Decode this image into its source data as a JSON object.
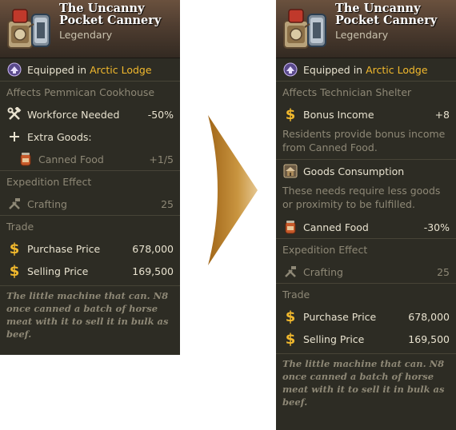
{
  "item": {
    "title": "The Uncanny Pocket Cannery",
    "rarity": "Legendary",
    "equipped_prefix": "Equipped in",
    "equipped_location": "Arctic Lodge",
    "flavor": "The little machine that can. N8 once canned a batch of horse meat with it to sell it in bulk as beef."
  },
  "before": {
    "affects": "Affects Pemmican Cookhouse",
    "workforce_label": "Workforce Needed",
    "workforce_value": "-50%",
    "extra_goods_label": "Extra Goods:",
    "canned_food_label": "Canned Food",
    "canned_food_value": "+1/5",
    "expedition_title": "Expedition Effect",
    "crafting_label": "Crafting",
    "crafting_value": "25",
    "trade_title": "Trade",
    "purchase_label": "Purchase Price",
    "purchase_value": "678,000",
    "selling_label": "Selling Price",
    "selling_value": "169,500"
  },
  "after": {
    "affects": "Affects Technician Shelter",
    "bonus_label": "Bonus Income",
    "bonus_value": "+8",
    "bonus_desc": "Residents provide bonus income from Canned Food.",
    "consumption_label": "Goods Consumption",
    "consumption_desc": "These needs require less goods or proximity to be fulfilled.",
    "canned_food_label": "Canned Food",
    "canned_food_value": "-30%",
    "expedition_title": "Expedition Effect",
    "crafting_label": "Crafting",
    "crafting_value": "25",
    "trade_title": "Trade",
    "purchase_label": "Purchase Price",
    "purchase_value": "678,000",
    "selling_label": "Selling Price",
    "selling_value": "169,500"
  },
  "colors": {
    "panel_bg": "#2d2c24",
    "accent_gold": "#f2b92d",
    "dim_text": "#8e8876",
    "arrow": "#b07a22"
  },
  "icons": [
    "cannery-item-icon",
    "lodge-badge-icon",
    "hammer-wrench-icon",
    "plus-icon",
    "canned-food-icon",
    "crafting-icon",
    "coin-dollar-icon",
    "shelter-icon",
    "transition-arrow-icon"
  ]
}
